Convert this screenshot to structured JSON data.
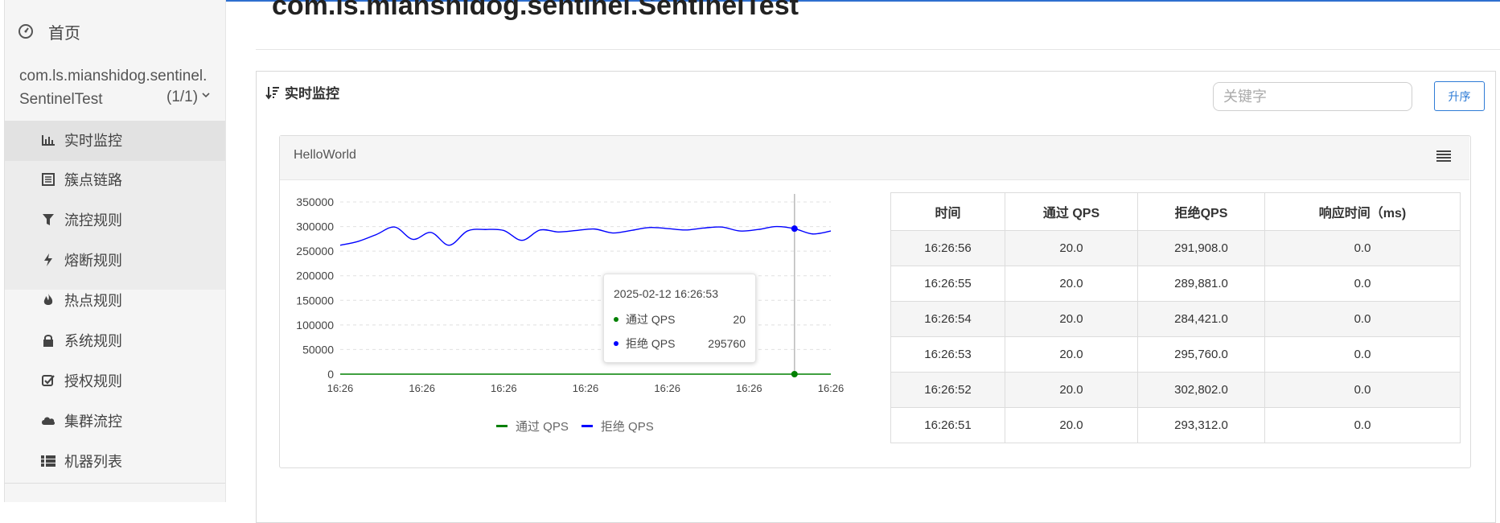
{
  "sidebar": {
    "home": "首页",
    "app_name": "com.ls.mianshidog.sentinel.SentinelTest",
    "app_count": "(1/1)",
    "items": [
      {
        "label": "实时监控",
        "icon": "bar-chart-icon"
      },
      {
        "label": "簇点链路",
        "icon": "list-icon"
      },
      {
        "label": "流控规则",
        "icon": "filter-icon"
      },
      {
        "label": "熔断规则",
        "icon": "bolt-icon"
      },
      {
        "label": "热点规则",
        "icon": "fire-icon"
      },
      {
        "label": "系统规则",
        "icon": "lock-icon"
      },
      {
        "label": "授权规则",
        "icon": "check-square-icon"
      },
      {
        "label": "集群流控",
        "icon": "cloud-icon"
      },
      {
        "label": "机器列表",
        "icon": "th-list-icon"
      }
    ]
  },
  "page": {
    "title": "com.ls.mianshidog.sentinel.SentinelTest"
  },
  "panel": {
    "title": "实时监控",
    "search_placeholder": "关键字",
    "sort_label": "升序"
  },
  "card": {
    "title": "HelloWorld"
  },
  "chart_data": {
    "type": "line",
    "x": [
      "16:26",
      "16:26",
      "16:26",
      "16:26",
      "16:26",
      "16:26",
      "16:26"
    ],
    "ylim": [
      0,
      350000
    ],
    "yticks": [
      "350000",
      "300000",
      "250000",
      "200000",
      "150000",
      "100000",
      "50000",
      "0"
    ],
    "series": [
      {
        "name": "通过 QPS",
        "color": "#008000",
        "values": [
          20,
          20,
          20,
          20,
          20,
          20,
          20,
          20,
          20,
          20,
          20,
          20,
          20,
          20,
          20,
          20,
          20,
          20,
          20,
          20,
          20,
          20,
          20,
          20,
          20,
          20,
          20,
          20
        ]
      },
      {
        "name": "拒绝 QPS",
        "color": "#0000ff",
        "values": [
          262000,
          270000,
          284000,
          299000,
          274000,
          288000,
          262000,
          291000,
          294000,
          292000,
          272000,
          293000,
          289000,
          292000,
          295000,
          287000,
          292000,
          298000,
          296000,
          293000,
          297000,
          299000,
          291000,
          294000,
          300000,
          295760,
          285000,
          291000
        ]
      }
    ],
    "legend": "bottom-center",
    "grid": true,
    "tooltip": {
      "title": "2025-02-12 16:26:53",
      "rows": [
        {
          "name": "通过 QPS",
          "value": "20",
          "color": "#008000"
        },
        {
          "name": "拒绝 QPS",
          "value": "295760",
          "color": "#0000ff"
        }
      ]
    }
  },
  "table": {
    "headers": [
      "时间",
      "通过 QPS",
      "拒绝QPS",
      "响应时间（ms)"
    ],
    "rows": [
      [
        "16:26:56",
        "20.0",
        "291,908.0",
        "0.0"
      ],
      [
        "16:26:55",
        "20.0",
        "289,881.0",
        "0.0"
      ],
      [
        "16:26:54",
        "20.0",
        "284,421.0",
        "0.0"
      ],
      [
        "16:26:53",
        "20.0",
        "295,760.0",
        "0.0"
      ],
      [
        "16:26:52",
        "20.0",
        "302,802.0",
        "0.0"
      ],
      [
        "16:26:51",
        "20.0",
        "293,312.0",
        "0.0"
      ]
    ]
  }
}
